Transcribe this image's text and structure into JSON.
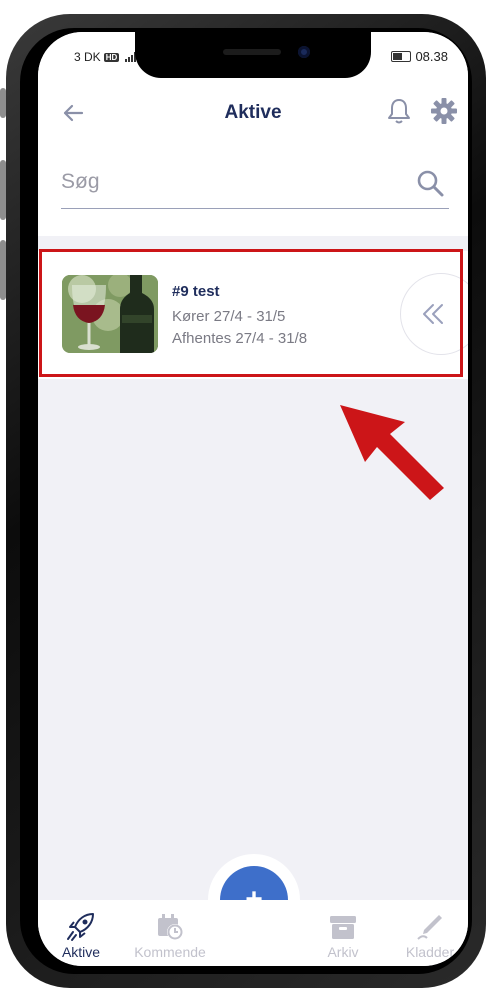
{
  "status_bar": {
    "carrier": "3 DK",
    "hd_badge": "HD",
    "time": "08.38"
  },
  "header": {
    "title": "Aktive"
  },
  "search": {
    "placeholder": "Søg"
  },
  "card": {
    "title": "#9 test",
    "line1": "Kører 27/4 - 31/5",
    "line2": "Afhentes 27/4 - 31/8"
  },
  "tabs": [
    {
      "label": "Aktive",
      "icon": "rocket-icon",
      "active": true
    },
    {
      "label": "Kommende",
      "icon": "calendar-clock-icon",
      "active": false
    },
    {
      "label": "Arkiv",
      "icon": "archive-box-icon",
      "active": false
    },
    {
      "label": "Kladder",
      "icon": "pencil-icon",
      "active": false
    }
  ],
  "fab": {
    "label": "+"
  },
  "colors": {
    "primary": "#1f2d5c",
    "accent": "#3e6fca",
    "annotation": "#cc1518",
    "background": "#f1f1f6"
  }
}
